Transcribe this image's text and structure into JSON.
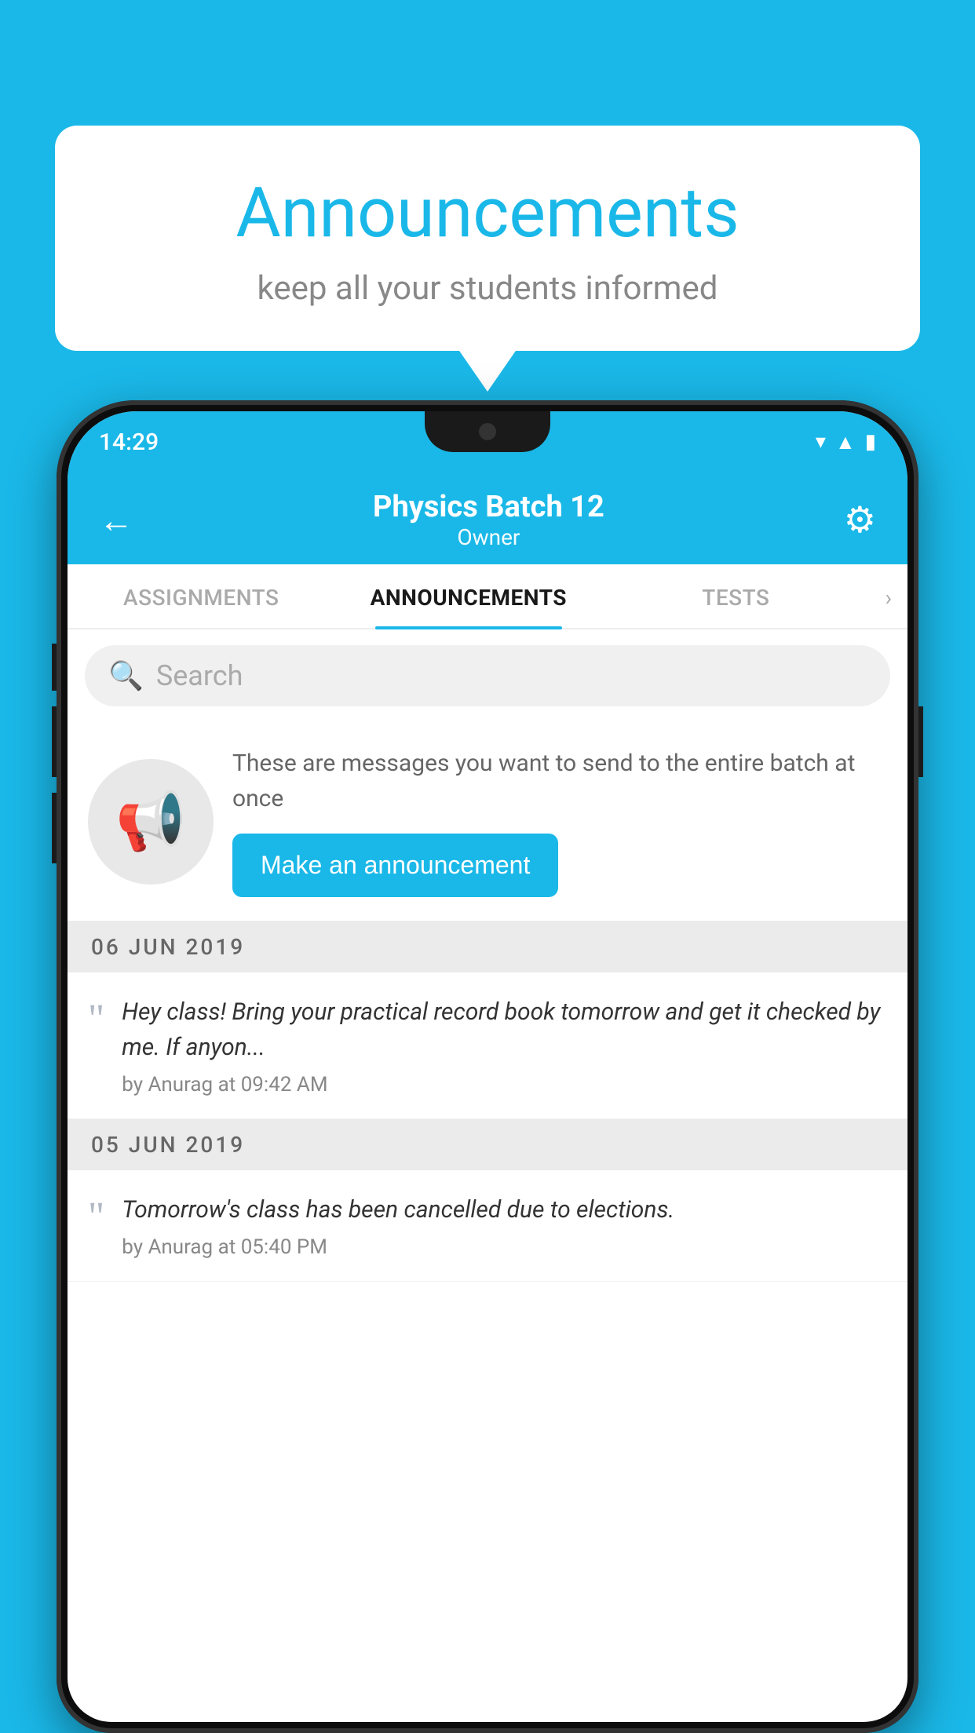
{
  "background_color": "#1ab8e8",
  "speech_bubble": {
    "title": "Announcements",
    "subtitle": "keep all your students informed"
  },
  "phone": {
    "status_bar": {
      "time": "14:29",
      "icons": [
        "wifi",
        "signal",
        "battery"
      ]
    },
    "header": {
      "batch_name": "Physics Batch 12",
      "role": "Owner",
      "back_label": "←",
      "settings_label": "⚙"
    },
    "tabs": [
      {
        "label": "ASSIGNMENTS",
        "active": false
      },
      {
        "label": "ANNOUNCEMENTS",
        "active": true
      },
      {
        "label": "TESTS",
        "active": false
      },
      {
        "label": "›",
        "active": false
      }
    ],
    "search": {
      "placeholder": "Search"
    },
    "promo": {
      "description": "These are messages you want to send to the entire batch at once",
      "button_label": "Make an announcement"
    },
    "announcements": [
      {
        "date": "06  JUN  2019",
        "text": "Hey class! Bring your practical record book tomorrow and get it checked by me. If anyon...",
        "meta": "by Anurag at 09:42 AM"
      },
      {
        "date": "05  JUN  2019",
        "text": "Tomorrow's class has been cancelled due to elections.",
        "meta": "by Anurag at 05:40 PM"
      }
    ]
  }
}
